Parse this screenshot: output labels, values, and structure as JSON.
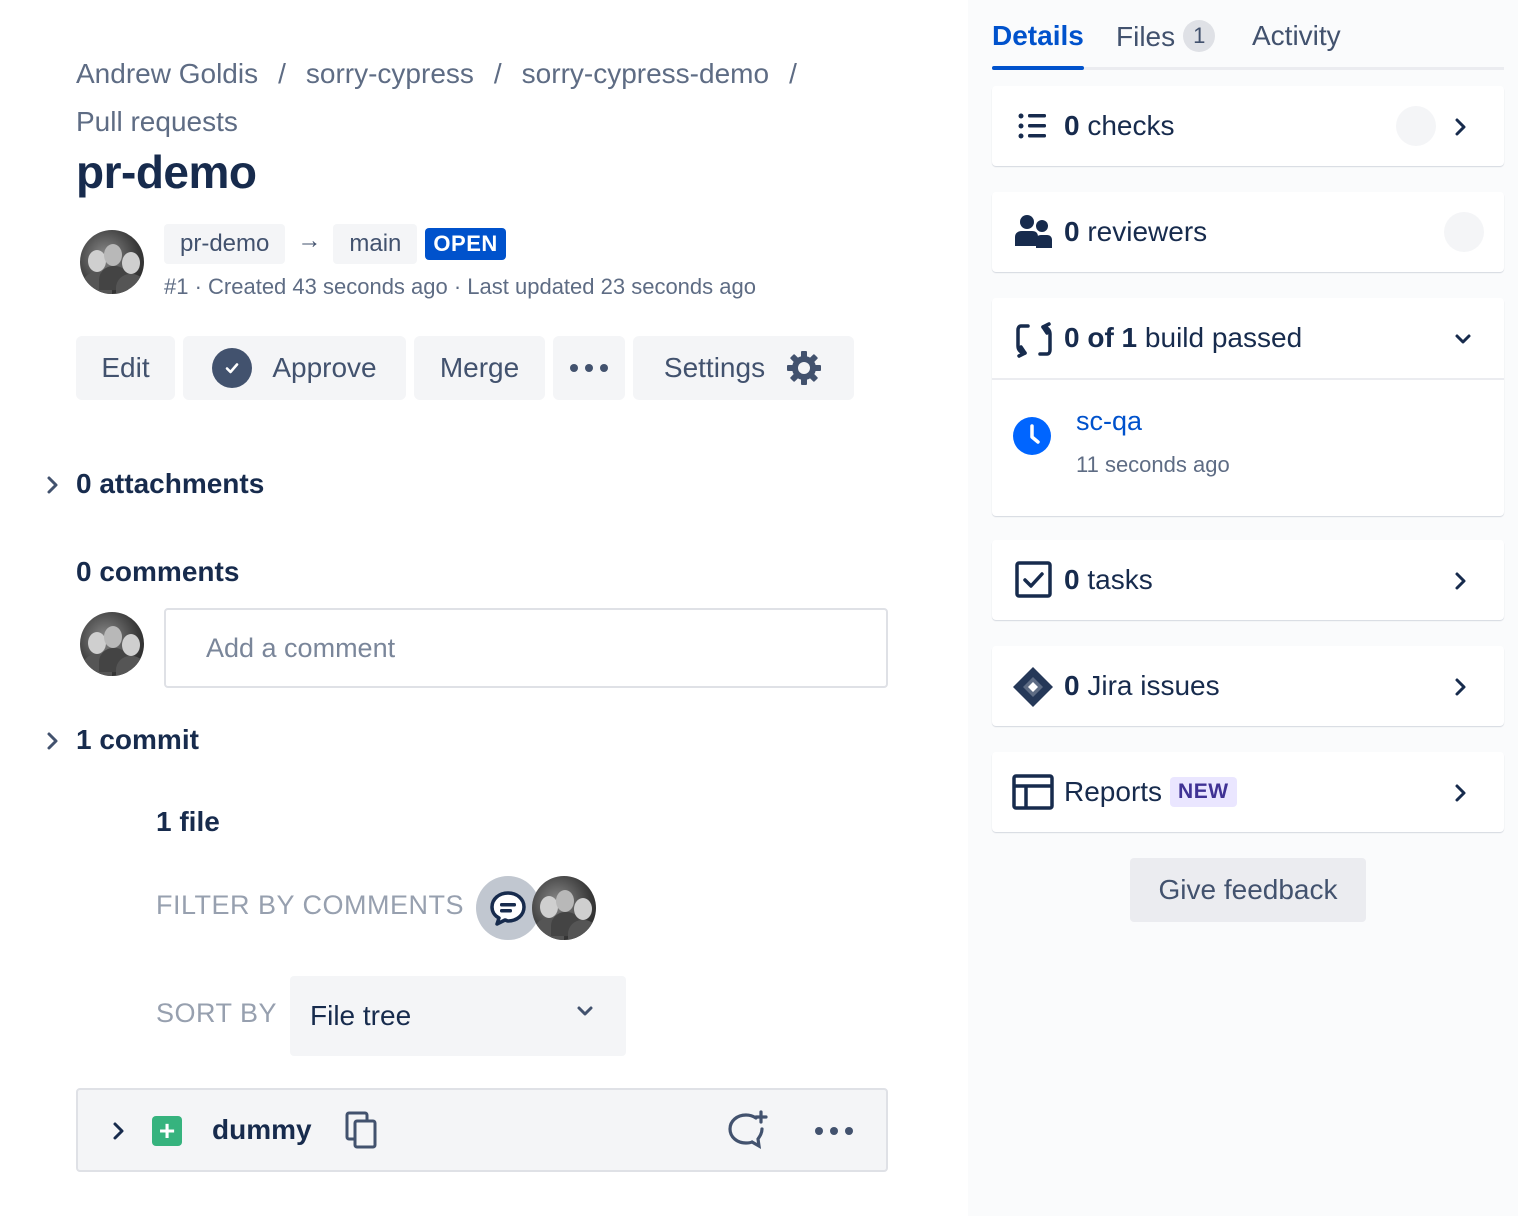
{
  "breadcrumb": {
    "items": [
      "Andrew Goldis",
      "sorry-cypress",
      "sorry-cypress-demo",
      "Pull requests"
    ],
    "separator": "/"
  },
  "pr": {
    "title": "pr-demo",
    "source_branch": "pr-demo",
    "target_branch": "main",
    "status": "OPEN",
    "meta": "#1 · Created 43 seconds ago · Last updated 23 seconds ago"
  },
  "actions": {
    "edit": "Edit",
    "approve": "Approve",
    "merge": "Merge",
    "settings": "Settings"
  },
  "attachments": {
    "label": "0 attachments"
  },
  "comments": {
    "label": "0 comments",
    "placeholder": "Add a comment"
  },
  "commits": {
    "label": "1 commit"
  },
  "files": {
    "count_label": "1 file",
    "filter_label": "FILTER BY COMMENTS",
    "sort_label": "SORT BY",
    "sort_value": "File tree",
    "items": [
      {
        "name": "dummy",
        "change": "added"
      }
    ]
  },
  "sidebar": {
    "tabs": {
      "details": "Details",
      "files": "Files",
      "files_count": "1",
      "activity": "Activity"
    },
    "checks": {
      "count": "0",
      "label": "checks"
    },
    "reviewers": {
      "count": "0",
      "label": "reviewers"
    },
    "builds": {
      "count": "0 of 1",
      "label": "build passed",
      "items": [
        {
          "name": "sc-qa",
          "time": "11 seconds ago",
          "status_color": "#0065ff"
        }
      ]
    },
    "tasks": {
      "count": "0",
      "label": "tasks"
    },
    "jira": {
      "count": "0",
      "label": "Jira issues"
    },
    "reports": {
      "label": "Reports",
      "badge": "NEW"
    },
    "feedback": "Give feedback"
  },
  "colors": {
    "primary": "#0052cc",
    "text": "#172b4d",
    "subtle": "#5e6c84",
    "added": "#36b37e"
  }
}
